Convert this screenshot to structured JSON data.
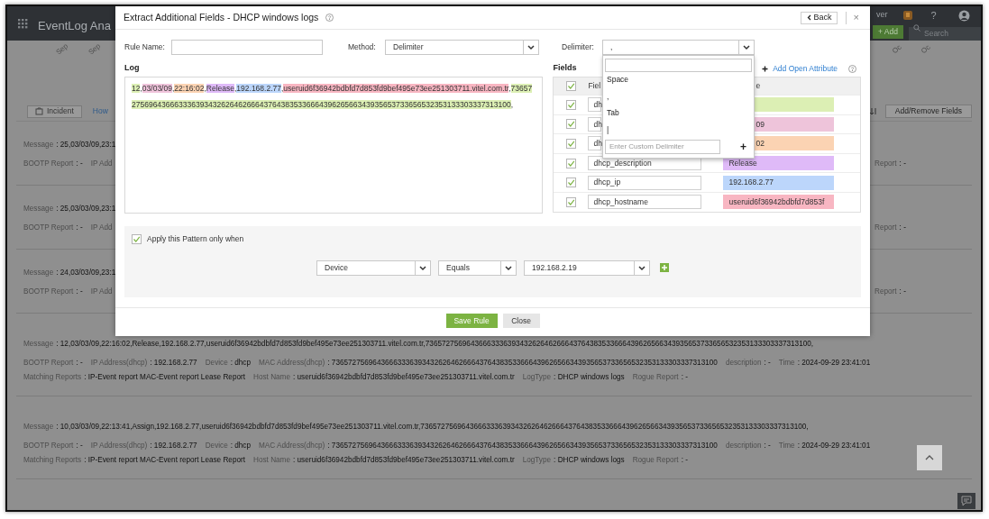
{
  "background": {
    "app_name": "EventLog Ana",
    "user_text": "ver",
    "help_symbol": "?",
    "add_button": "+ Add",
    "search_placeholder": "Search",
    "column_labels_left": [
      "Sep",
      "Sep"
    ],
    "column_labels_right": [
      "Oc",
      "Oc"
    ],
    "toolbar": {
      "incident_button": "Incident",
      "how_link": "How",
      "add_remove_button": "Add/Remove Fields"
    },
    "entries": [
      {
        "kind": "cut",
        "message": {
          "label": "Message",
          "value": ": 25,03/03/09,23:1"
        },
        "lines": [
          {
            "items": [
              {
                "label": "BOOTP Report",
                "value": ": -"
              },
              {
                "label": "IP Add"
              }
            ],
            "right": {
              "label": "Report",
              "value": ": -"
            }
          }
        ]
      },
      {
        "kind": "cut",
        "message": {
          "label": "Message",
          "value": ": 25,03/03/09,23:1"
        },
        "lines": [
          {
            "items": [
              {
                "label": "BOOTP Report",
                "value": ": -"
              },
              {
                "label": "IP Add"
              }
            ],
            "right": {
              "label": "Report",
              "value": ": -"
            }
          }
        ]
      },
      {
        "kind": "cut",
        "message": {
          "label": "Message",
          "value": ": 24,03/03/09,23:1"
        },
        "lines": [
          {
            "items": [
              {
                "label": "BOOTP Report",
                "value": ": -"
              },
              {
                "label": "IP Add"
              }
            ],
            "right": {
              "label": "Report",
              "value": ": -"
            }
          }
        ]
      },
      {
        "kind": "full",
        "message": {
          "label": "Message",
          "value": ": 12,03/03/09,22:16:02,Release,192.168.2.77,useruid6f36942bdbfd7d853fd9bef495e73ee251303711.vitel.com.tr,7365727569643666333639343262646266643764383533666439626566343935653733656532353133303337313100,"
        },
        "lines": [
          {
            "items": [
              {
                "label": "BOOTP Report",
                "value": ": -"
              },
              {
                "label": "IP Address(dhcp)",
                "value": ": 192.168.2.77"
              },
              {
                "label": "Device",
                "value": ": dhcp"
              },
              {
                "label": "MAC Address(dhcp)",
                "value": ": 7365727569643666333639343262646266643764383533666439626566343935653733656532353133303337313100"
              },
              {
                "label": "description",
                "value": ": -"
              },
              {
                "label": "Time",
                "value": ": 2024-09-29 23:41:01"
              }
            ]
          },
          {
            "items": [
              {
                "label": "Matching Reports",
                "value": ": IP-Event report MAC-Event report Lease Report"
              },
              {
                "label": "Host Name",
                "value": ": useruid6f36942bdbfd7d853fd9bef495e73ee251303711.vitel.com.tr"
              },
              {
                "label": "LogType",
                "value": ": DHCP windows logs"
              },
              {
                "label": "Rogue Report",
                "value": ": -"
              }
            ]
          }
        ]
      },
      {
        "kind": "full",
        "message": {
          "label": "Message",
          "value": ": 10,03/03/09,22:13:41,Assign,192.168.2.77,useruid6f36942bdbfd7d853fd9bef495e73ee251303711.vitel.com.tr,7365727569643666333639343262646266643764383533666439626566343935653733656532353133303337313100,"
        },
        "lines": [
          {
            "items": [
              {
                "label": "BOOTP Report",
                "value": ": -"
              },
              {
                "label": "IP Address(dhcp)",
                "value": ": 192.168.2.77"
              },
              {
                "label": "Device",
                "value": ": dhcp"
              },
              {
                "label": "MAC Address(dhcp)",
                "value": ": 7365727569643666333639343262646266643764383533666439626566343935653733656532353133303337313100"
              },
              {
                "label": "description",
                "value": ": -"
              },
              {
                "label": "Time",
                "value": ": 2024-09-29 23:41:01"
              }
            ]
          },
          {
            "items": [
              {
                "label": "Matching Reports",
                "value": ": IP-Event report MAC-Event report Lease Report"
              },
              {
                "label": "Host Name",
                "value": ": useruid6f36942bdbfd7d853fd9bef495e73ee251303711.vitel.com.tr"
              },
              {
                "label": "LogType",
                "value": ": DHCP windows logs"
              },
              {
                "label": "Rogue Report",
                "value": ": -"
              }
            ]
          }
        ]
      }
    ]
  },
  "modal": {
    "title": "Extract Additional Fields - DHCP windows logs",
    "back_button": "Back",
    "close_button": "×",
    "rule_name": {
      "label": "Rule Name:"
    },
    "method": {
      "label": "Method:",
      "value": "Delimiter"
    },
    "delimiter": {
      "label": "Delimiter:",
      "value": ",",
      "expanded": true,
      "options": [
        {
          "label": "Space"
        },
        {
          "label": ","
        },
        {
          "label": "Tab"
        },
        {
          "label": "|"
        }
      ],
      "custom_placeholder": "Enter Custom Delimiter",
      "add_symbol": "+"
    },
    "log": {
      "label": "Log",
      "separator": ",",
      "segments": [
        {
          "text": "12",
          "color": "#dcefb4"
        },
        {
          "text": "03/03/09",
          "color": "#f0c4dc"
        },
        {
          "text": "22:16:02",
          "color": "#fbd3b3"
        },
        {
          "text": "Release",
          "color": "#dfbaf8"
        },
        {
          "text": "192.168.2.77",
          "color": "#bcd6fb"
        },
        {
          "text": "useruid6f36942bdbfd7d853fd9bef495e73ee251303711.vitel.com.tr",
          "color": "#f8b6c2"
        },
        {
          "text": "7365727569643666333639343262646266643764383533666439626566343935653733656532353133303337313100",
          "color": "#dcefb4"
        }
      ]
    },
    "fields": {
      "label": "Fields",
      "add_attribute": "Add Open Attribute",
      "columns": [
        "Fiel",
        "e"
      ],
      "all_checked": true,
      "rows": [
        {
          "name": "dh",
          "checked": true,
          "covered": true,
          "color": "#dcefb4"
        },
        {
          "name": "dh",
          "value": "09",
          "checked": true,
          "covered": true,
          "color": "#eec4da"
        },
        {
          "name": "dh",
          "value": "02",
          "checked": true,
          "covered": true,
          "color": "#fbd3b3"
        },
        {
          "name": "dhcp_description",
          "value": "Release",
          "checked": true,
          "covered": false,
          "color": "#dfbaf8"
        },
        {
          "name": "dhcp_ip",
          "value": "192.168.2.77",
          "checked": true,
          "covered": false,
          "color": "#bcd6fb"
        },
        {
          "name": "dhcp_hostname",
          "value": "useruid6f36942bdbfd7d853f",
          "checked": true,
          "covered": false,
          "color": "#f8b6c2"
        }
      ]
    },
    "condition": {
      "label": "Apply this Pattern only when",
      "checked": true,
      "field": "Device",
      "operator": "Equals",
      "value": "192.168.2.19"
    },
    "footer": {
      "save_button": "Save Rule",
      "close_button": "Close"
    }
  }
}
